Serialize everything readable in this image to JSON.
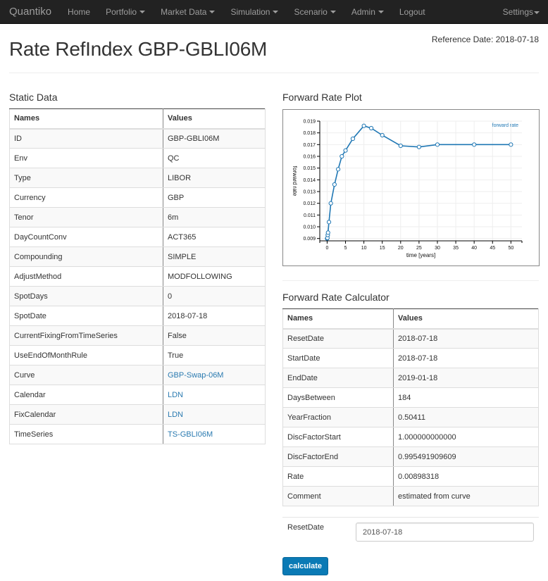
{
  "navbar": {
    "brand": "Quantiko",
    "items": [
      {
        "label": "Home",
        "dropdown": false
      },
      {
        "label": "Portfolio",
        "dropdown": true
      },
      {
        "label": "Market Data",
        "dropdown": true
      },
      {
        "label": "Simulation",
        "dropdown": true
      },
      {
        "label": "Scenario",
        "dropdown": true
      },
      {
        "label": "Admin",
        "dropdown": true
      },
      {
        "label": "Logout",
        "dropdown": false
      }
    ],
    "settings": "Settings"
  },
  "header": {
    "title": "Rate RefIndex GBP-GBLI06M",
    "reference_date": "Reference Date: 2018-07-18"
  },
  "static_data": {
    "heading": "Static Data",
    "columns": [
      "Names",
      "Values"
    ],
    "rows": [
      {
        "name": "ID",
        "value": "GBP-GBLI06M",
        "link": false
      },
      {
        "name": "Env",
        "value": "QC",
        "link": false
      },
      {
        "name": "Type",
        "value": "LIBOR",
        "link": false
      },
      {
        "name": "Currency",
        "value": "GBP",
        "link": false
      },
      {
        "name": "Tenor",
        "value": "6m",
        "link": false
      },
      {
        "name": "DayCountConv",
        "value": "ACT365",
        "link": false
      },
      {
        "name": "Compounding",
        "value": "SIMPLE",
        "link": false
      },
      {
        "name": "AdjustMethod",
        "value": "MODFOLLOWING",
        "link": false
      },
      {
        "name": "SpotDays",
        "value": "0",
        "link": false
      },
      {
        "name": "SpotDate",
        "value": "2018-07-18",
        "link": false
      },
      {
        "name": "CurrentFixingFromTimeSeries",
        "value": "False",
        "link": false
      },
      {
        "name": "UseEndOfMonthRule",
        "value": "True",
        "link": false
      },
      {
        "name": "Curve",
        "value": "GBP-Swap-06M",
        "link": true
      },
      {
        "name": "Calendar",
        "value": "LDN",
        "link": true
      },
      {
        "name": "FixCalendar",
        "value": "LDN",
        "link": true
      },
      {
        "name": "TimeSeries",
        "value": "TS-GBLI06M",
        "link": true
      }
    ]
  },
  "plot": {
    "heading": "Forward Rate Plot"
  },
  "chart_data": {
    "type": "line",
    "title": "",
    "xlabel": "time [years]",
    "ylabel": "forward rate",
    "xlim": [
      -2,
      53
    ],
    "ylim": [
      0.0088,
      0.019
    ],
    "x_ticks": [
      0,
      5,
      10,
      15,
      20,
      25,
      30,
      35,
      40,
      45,
      50
    ],
    "y_ticks": [
      0.009,
      0.01,
      0.011,
      0.012,
      0.013,
      0.014,
      0.015,
      0.016,
      0.017,
      0.018,
      0.019
    ],
    "y_tick_labels": [
      "0.009",
      "0.010",
      "0.011",
      "0.012",
      "0.013",
      "0.014",
      "0.015",
      "0.016",
      "0.017",
      "0.018",
      "0.019"
    ],
    "grid": true,
    "legend_position": "top-right",
    "series": [
      {
        "name": "forward rate",
        "color": "#1f77b4",
        "x": [
          0,
          0.08,
          0.17,
          0.25,
          0.5,
          1,
          2,
          3,
          4,
          5,
          7,
          10,
          12,
          15,
          20,
          25,
          30,
          40,
          50
        ],
        "y": [
          0.009,
          0.00905,
          0.0093,
          0.0095,
          0.0104,
          0.012,
          0.0136,
          0.0149,
          0.016,
          0.0165,
          0.0175,
          0.0186,
          0.0184,
          0.0178,
          0.0169,
          0.0168,
          0.017,
          0.017,
          0.017
        ]
      }
    ]
  },
  "calculator": {
    "heading": "Forward Rate Calculator",
    "columns": [
      "Names",
      "Values"
    ],
    "rows": [
      {
        "name": "ResetDate",
        "value": "2018-07-18"
      },
      {
        "name": "StartDate",
        "value": "2018-07-18"
      },
      {
        "name": "EndDate",
        "value": "2019-01-18"
      },
      {
        "name": "DaysBetween",
        "value": "184"
      },
      {
        "name": "YearFraction",
        "value": "0.50411"
      },
      {
        "name": "DiscFactorStart",
        "value": "1.000000000000"
      },
      {
        "name": "DiscFactorEnd",
        "value": "0.995491909609"
      },
      {
        "name": "Rate",
        "value": "0.00898318"
      },
      {
        "name": "Comment",
        "value": "estimated from curve"
      }
    ],
    "form": {
      "reset_date_label": "ResetDate",
      "reset_date_value": "2018-07-18",
      "calculate_label": "calculate"
    }
  },
  "colors": {
    "navbar_bg": "#222222",
    "link": "#2a7ab0",
    "primary_button": "#0a7ab5",
    "series_line": "#1f77b4"
  }
}
